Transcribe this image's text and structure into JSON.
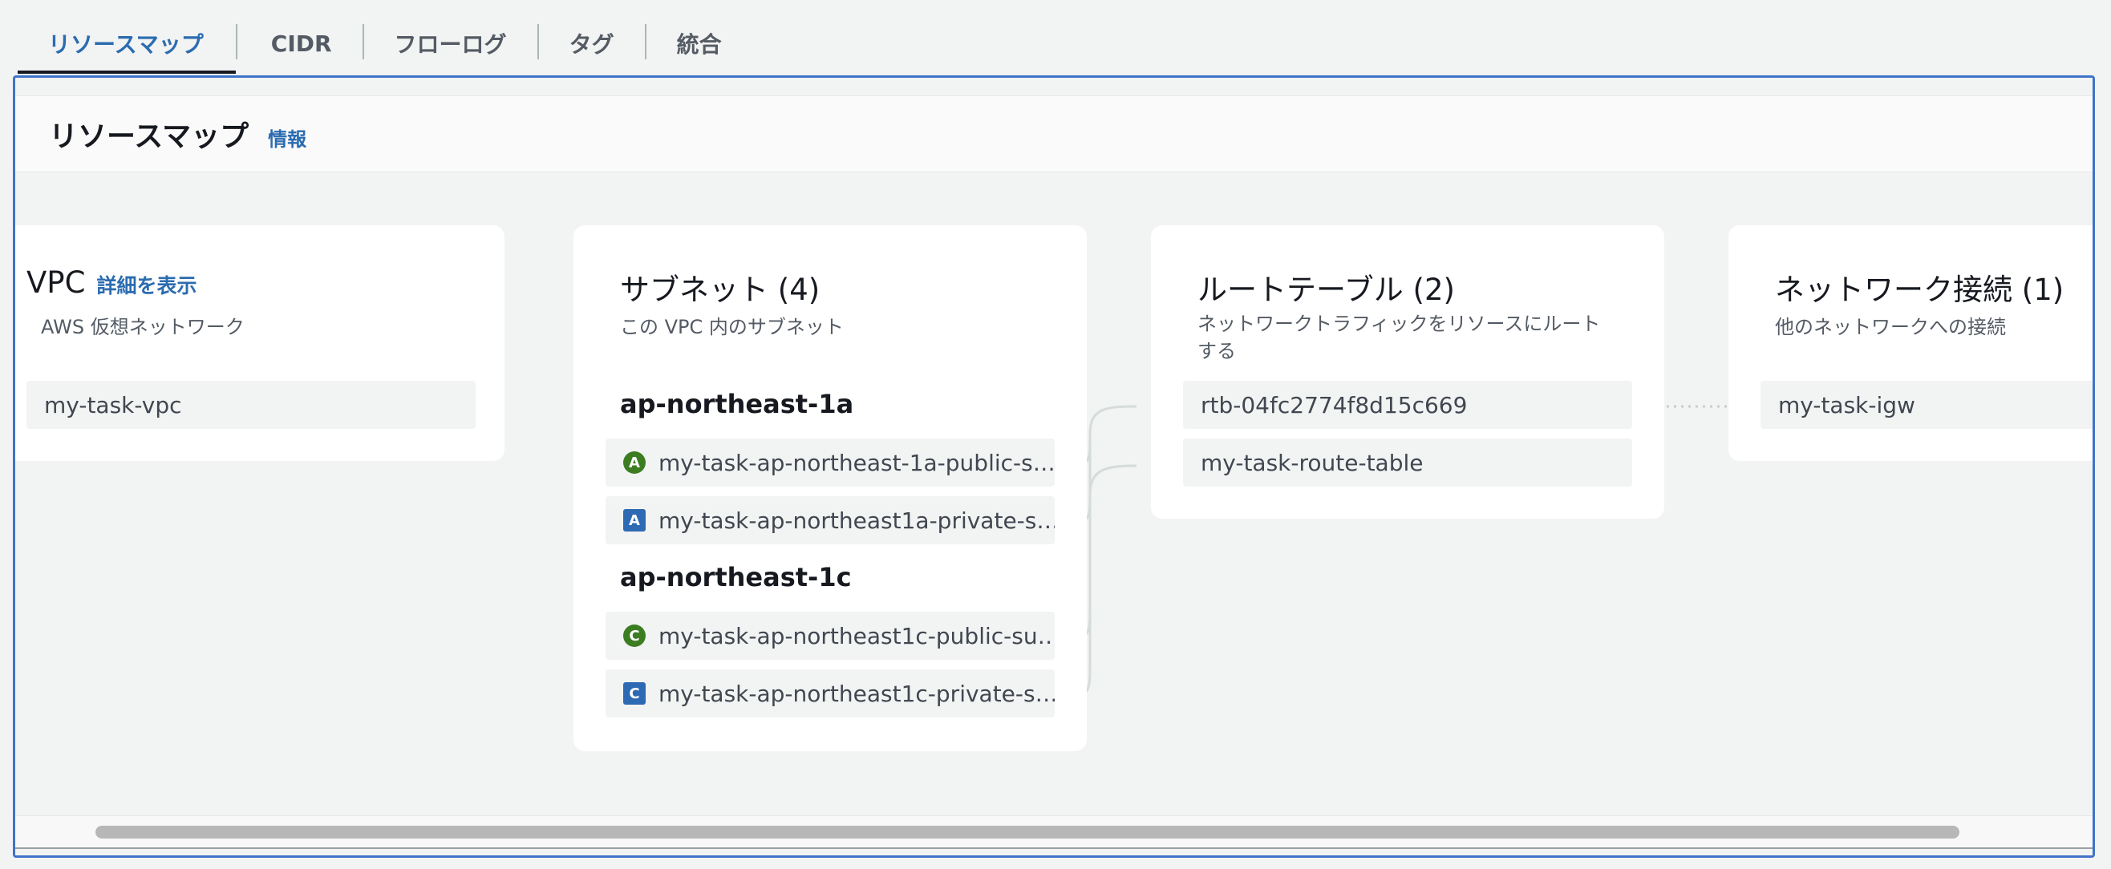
{
  "tabs": [
    {
      "label": "リソースマップ"
    },
    {
      "label": "CIDR"
    },
    {
      "label": "フローログ"
    },
    {
      "label": "タグ"
    },
    {
      "label": "統合"
    }
  ],
  "panel": {
    "title": "リソースマップ",
    "info": "情報"
  },
  "vpc": {
    "title": "VPC",
    "details_link": "詳細を表示",
    "description": "AWS 仮想ネットワーク",
    "items": [
      "my-task-vpc"
    ]
  },
  "subnets": {
    "title": "サブネット (4)",
    "description": "この VPC 内のサブネット",
    "zones": [
      {
        "name": "ap-northeast-1a",
        "items": [
          {
            "icon": "A",
            "shape": "circle",
            "label": "my-task-ap-northeast-1a-public-s…"
          },
          {
            "icon": "A",
            "shape": "square",
            "label": "my-task-ap-northeast1a-private-s…"
          }
        ]
      },
      {
        "name": "ap-northeast-1c",
        "items": [
          {
            "icon": "C",
            "shape": "circle",
            "label": "my-task-ap-northeast1c-public-su…"
          },
          {
            "icon": "C",
            "shape": "square",
            "label": "my-task-ap-northeast1c-private-s…"
          }
        ]
      }
    ]
  },
  "route_tables": {
    "title": "ルートテーブル (2)",
    "description_line1": "ネットワークトラフィックをリソースにルート",
    "description_line2": "する",
    "items": [
      "rtb-04fc2774f8d15c669",
      "my-task-route-table"
    ]
  },
  "network_connections": {
    "title": "ネットワーク接続 (1)",
    "description": "他のネットワークへの接続",
    "items": [
      "my-task-igw"
    ]
  },
  "colors": {
    "accent": "#2b6cb0",
    "public_subnet_icon": "#3c7d22",
    "private_subnet_icon": "#2e6ab3",
    "panel_border": "#3f73c9"
  }
}
